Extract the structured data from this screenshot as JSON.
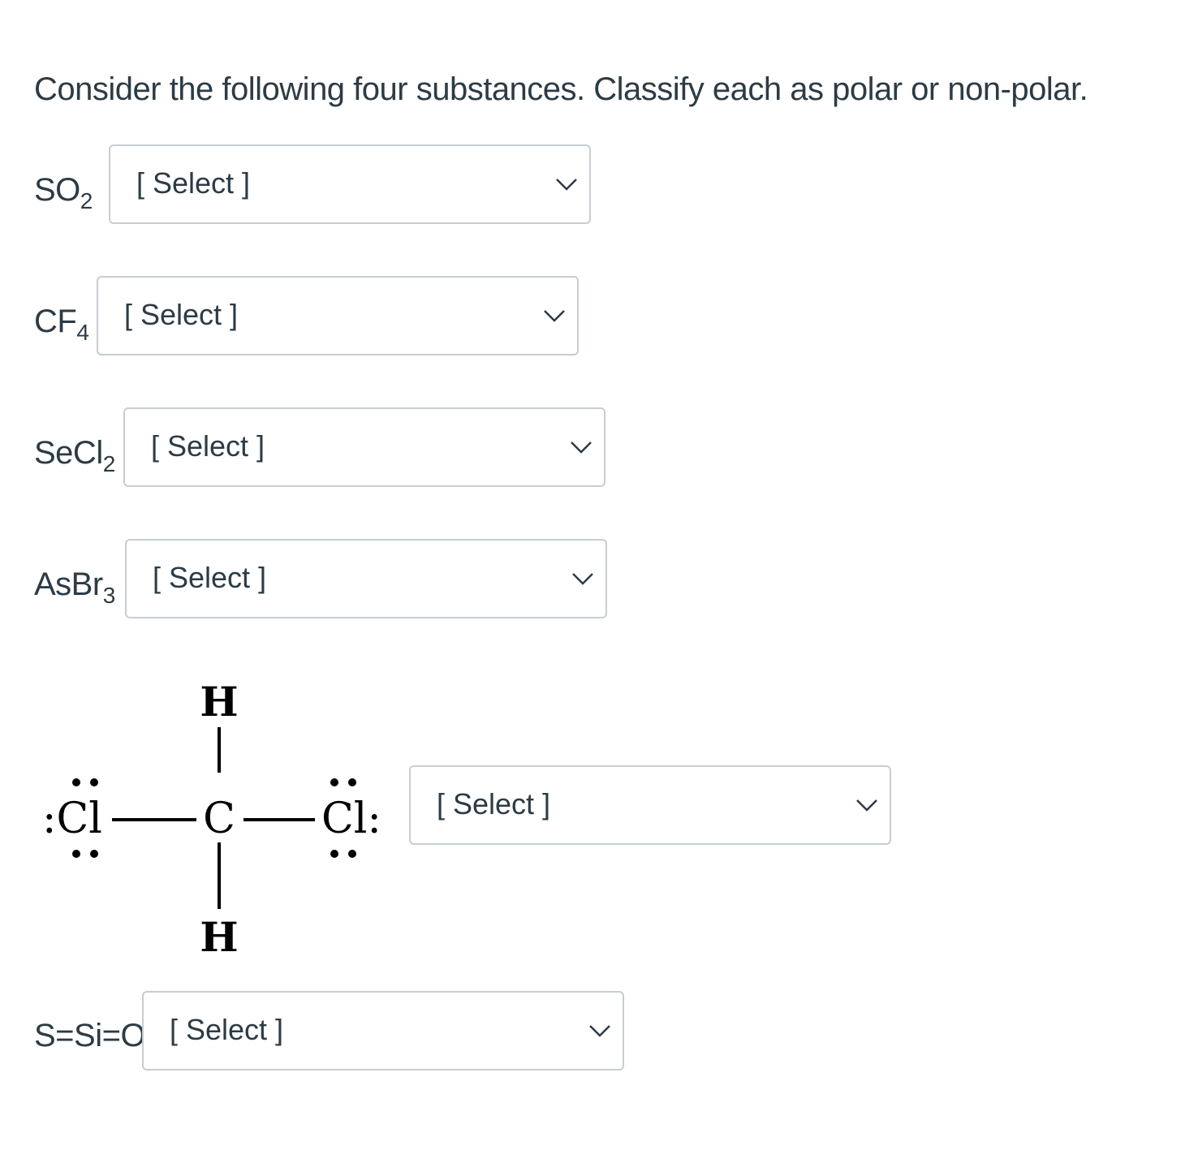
{
  "question": "Consider the following four substances. Classify each as polar or non-polar.",
  "items": [
    {
      "formula_main": "SO",
      "formula_sub": "2",
      "select_value": "[ Select ]"
    },
    {
      "formula_main": "CF",
      "formula_sub": "4",
      "select_value": "[ Select ]"
    },
    {
      "formula_main": "SeCl",
      "formula_sub": "2",
      "select_value": "[ Select ]"
    },
    {
      "formula_main": "AsBr",
      "formula_sub": "3",
      "select_value": "[ Select ]"
    },
    {
      "structure": {
        "left": ":Cl",
        "center": "C",
        "right": "Cl:",
        "top": "H",
        "bottom": "H"
      },
      "select_value": "[ Select ]"
    },
    {
      "formula_main": "S=Si=O",
      "select_value": "[ Select ]"
    }
  ],
  "icons": {
    "dropdown": "chevron-down-icon"
  }
}
